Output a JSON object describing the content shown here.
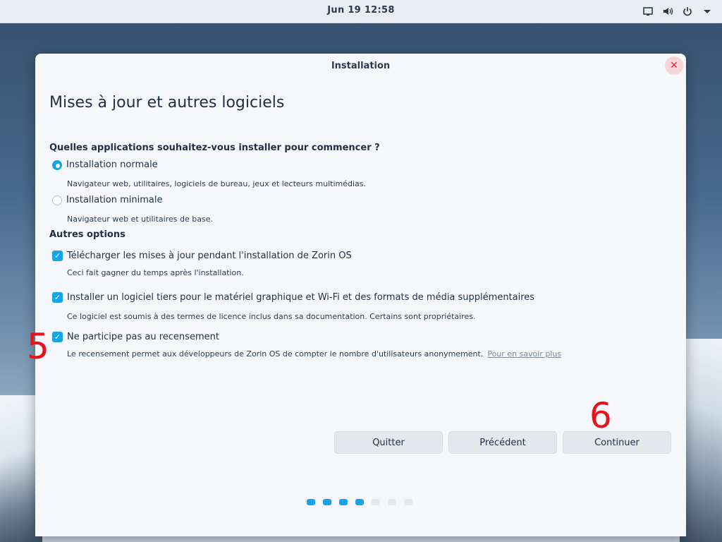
{
  "topbar": {
    "clock": "Jun 19  12:58",
    "icons": [
      "display-icon",
      "volume-icon",
      "power-icon",
      "chevron-down-icon"
    ]
  },
  "window": {
    "title": "Installation",
    "page_title": "Mises à jour et autres logiciels",
    "question": "Quelles applications souhaitez-vous installer pour commencer ?",
    "install_options": [
      {
        "label": "Installation normale",
        "description": "Navigateur web, utilitaires, logiciels de bureau, jeux et lecteurs multimédias.",
        "selected": true
      },
      {
        "label": "Installation minimale",
        "description": "Navigateur web et utilitaires de base.",
        "selected": false
      }
    ],
    "other_options_heading": "Autres options",
    "other_options": [
      {
        "label": "Télécharger les mises à jour pendant l'installation de Zorin OS",
        "description": "Ceci fait gagner du temps après l'installation.",
        "checked": true
      },
      {
        "label": "Installer un logiciel tiers pour le matériel graphique et Wi-Fi et des formats de média supplémentaires",
        "description": "Ce logiciel est soumis à des termes de licence inclus dans sa documentation. Certains sont propriétaires.",
        "checked": true
      },
      {
        "label": "Ne participe pas au recensement",
        "description": "Le recensement permet aux développeurs de Zorin OS de compter le nombre d'utilisateurs anonymement.",
        "link": "Pour en savoir plus",
        "checked": true
      }
    ],
    "buttons": {
      "quit": "Quitter",
      "back": "Précédent",
      "continue": "Continuer"
    },
    "progress": {
      "total_steps": 7,
      "completed_steps": 4
    }
  },
  "annotations": {
    "five": "5",
    "six": "6"
  },
  "colors": {
    "accent": "#15a4e6",
    "annotation": "#e8121c",
    "close": "#e0233a"
  }
}
